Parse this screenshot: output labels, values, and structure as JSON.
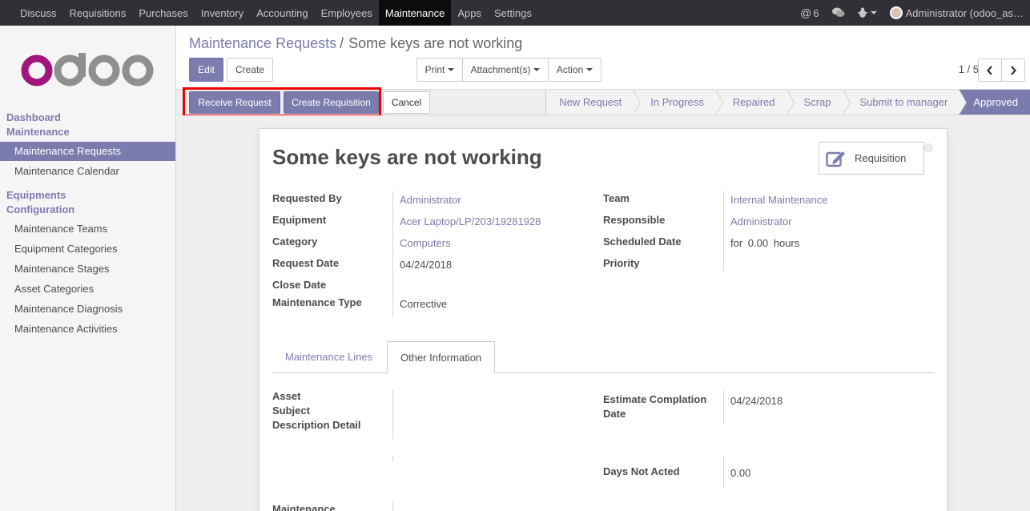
{
  "topnav": {
    "menu": [
      "Discuss",
      "Requisitions",
      "Purchases",
      "Inventory",
      "Accounting",
      "Employees",
      "Maintenance",
      "Apps",
      "Settings"
    ],
    "active": "Maintenance",
    "mentions_count": "6",
    "user": "Administrator (odoo_as…"
  },
  "sidebar": {
    "logo_text": "odoo",
    "section1": "Dashboard",
    "section2": "Maintenance",
    "items_a": [
      "Maintenance Requests",
      "Maintenance Calendar"
    ],
    "section3": "Equipments",
    "section4": "Configuration",
    "items_b": [
      "Maintenance Teams",
      "Equipment Categories",
      "Maintenance Stages",
      "Asset Categories",
      "Maintenance Diagnosis",
      "Maintenance Activities"
    ]
  },
  "control": {
    "breadcrumb_parent": "Maintenance Requests",
    "breadcrumb_sep": "/",
    "breadcrumb_current": "Some keys are not working",
    "edit": "Edit",
    "create": "Create",
    "print": "Print",
    "attachments": "Attachment(s)",
    "action": "Action",
    "pager": "1 / 5"
  },
  "statusbar": {
    "receive": "Receive Request",
    "create_requisition": "Create Requisition",
    "cancel": "Cancel",
    "stages": [
      "New Request",
      "In Progress",
      "Repaired",
      "Scrap",
      "Submit to manager",
      "Approved"
    ],
    "current_stage": "Approved"
  },
  "form": {
    "title": "Some keys are not working",
    "smart_button": "Requisition",
    "left_labels": [
      "Requested By",
      "Equipment",
      "Category",
      "Request Date",
      "Close Date",
      "Maintenance Type"
    ],
    "left_values": [
      "Administrator",
      "Acer Laptop/LP/203/19281928",
      "Computers",
      "04/24/2018",
      "",
      "Corrective"
    ],
    "right_labels": [
      "Team",
      "Responsible",
      "Scheduled Date",
      "Priority"
    ],
    "right_values": [
      "Internal Maintenance",
      "Administrator",
      "for",
      "0.00",
      "hours"
    ],
    "tabs": [
      "Maintenance Lines",
      "Other Information"
    ],
    "active_tab": "Other Information",
    "info_left_labels": [
      "Asset",
      "Subject",
      "Description Detail"
    ],
    "estimate_label_1": "Estimate Complation",
    "estimate_label_2": "Date",
    "estimate_value": "04/24/2018",
    "days_label": "Days Not Acted",
    "days_value": "0.00",
    "bottom_label": "Maintenance"
  },
  "colors": {
    "brand": "#7c7bad",
    "highlight": "#ee0000",
    "nav_bg": "#2f3136"
  }
}
